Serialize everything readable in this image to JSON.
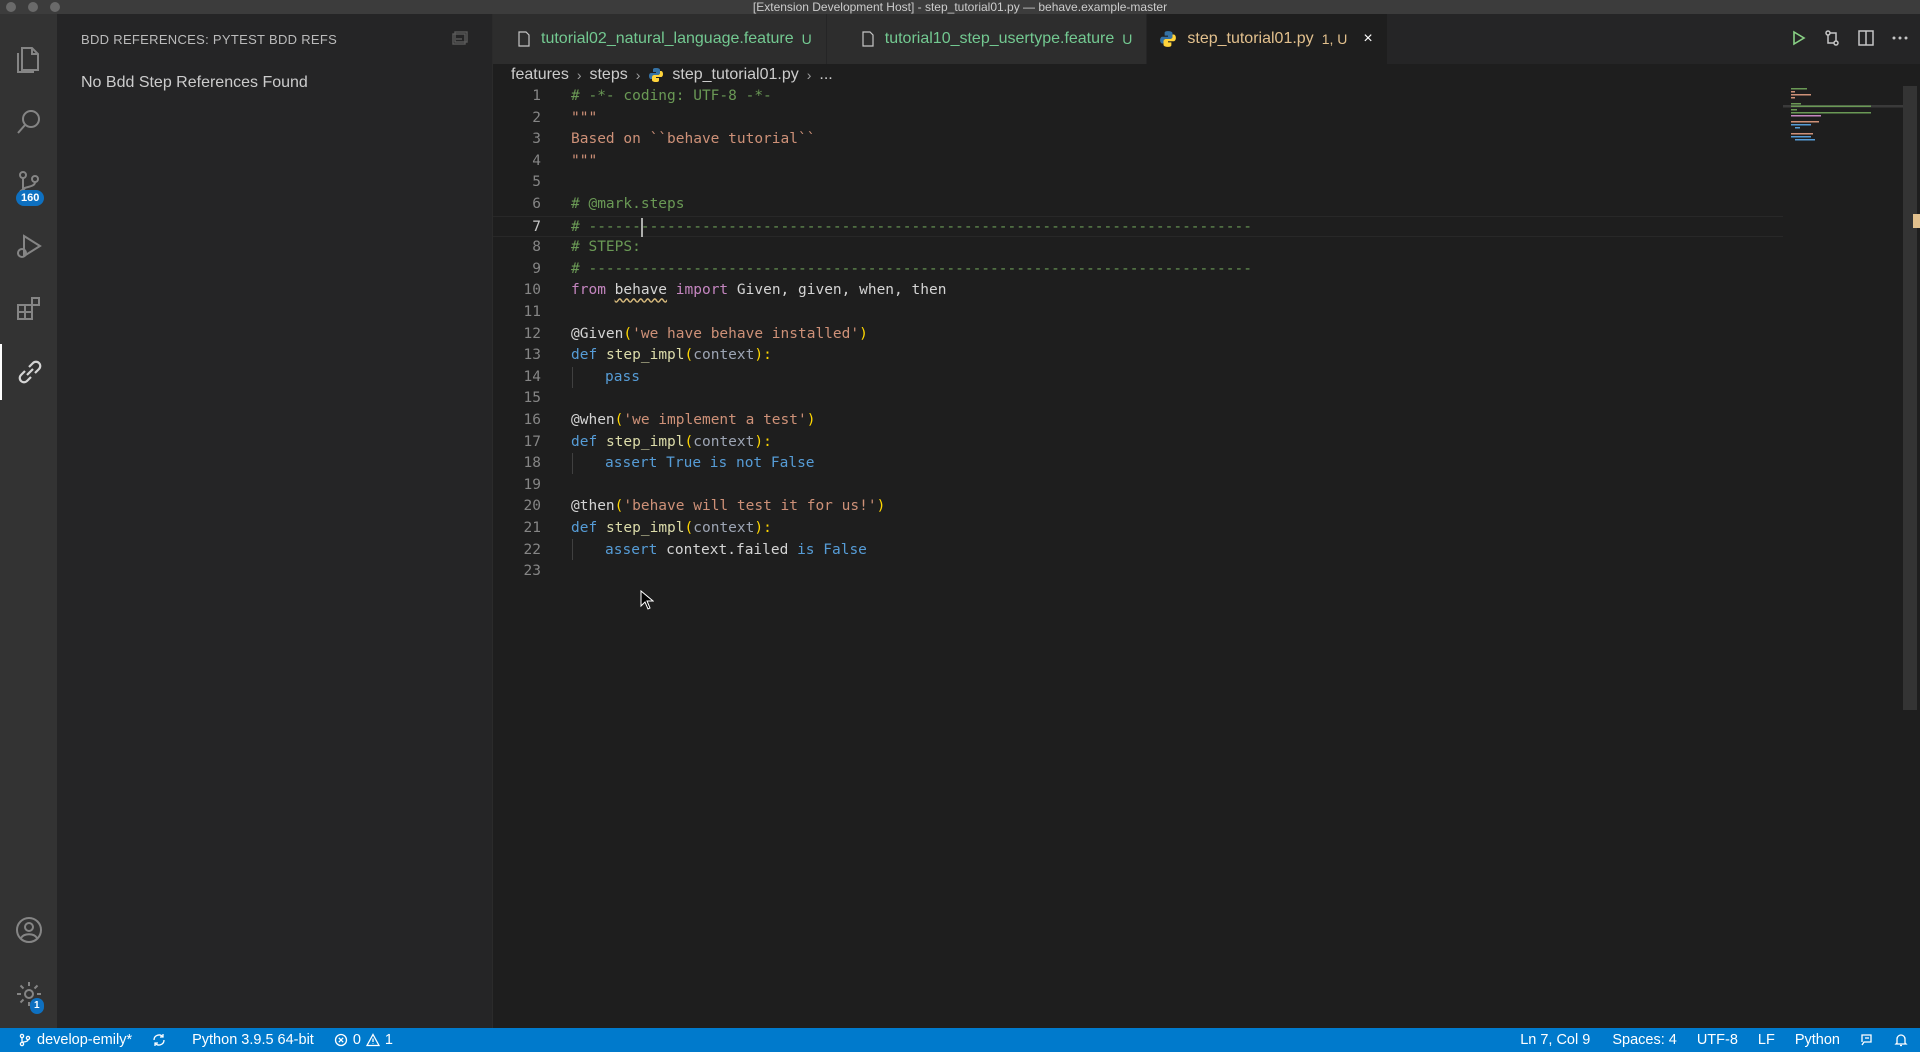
{
  "window": {
    "title": "[Extension Development Host] - step_tutorial01.py — behave.example-master"
  },
  "activity_bar": {
    "items": [
      "explorer-icon",
      "search-icon",
      "source-control-icon",
      "run-debug-icon",
      "extensions-icon",
      "bdd-references-icon"
    ],
    "scm_badge": "160",
    "settings_badge": "1",
    "accent": "#0e70c0"
  },
  "sidebar": {
    "title": "BDD REFERENCES: PYTEST BDD REFS",
    "message": "No Bdd Step References Found"
  },
  "tabs": [
    {
      "label": "tutorial02_natural_language.feature",
      "status": "U"
    },
    {
      "label": "tutorial10_step_usertype.feature",
      "status": "U"
    },
    {
      "label": "step_tutorial01.py",
      "status": "1, U",
      "close": "×"
    }
  ],
  "breadcrumbs": [
    "features",
    "steps",
    "step_tutorial01.py",
    "..."
  ],
  "editor": {
    "current_line": 7,
    "line_numbers": [
      "1",
      "2",
      "3",
      "4",
      "5",
      "6",
      "7",
      "8",
      "9",
      "10",
      "11",
      "12",
      "13",
      "14",
      "15",
      "16",
      "17",
      "18",
      "19",
      "20",
      "21",
      "22",
      "23"
    ],
    "lines": {
      "l1": "# -*- coding: UTF-8 -*-",
      "l2": "\"\"\"",
      "l3": "Based on ``behave tutorial``",
      "l4": "\"\"\"",
      "l6": "# @mark.steps",
      "l7": "# ----------------------------------------------------------------------------",
      "l8": "# STEPS:",
      "l9": "# ----------------------------------------------------------------------------",
      "l10": {
        "kw1": "from",
        "mod": "behave",
        "kw2": "import",
        "names": "Given, given, when, then"
      },
      "l12": {
        "deco": "@Given",
        "p1": "(",
        "str": "'we have behave installed'",
        "p2": ")"
      },
      "l13": {
        "kw": "def",
        "fn": "step_impl",
        "p1": "(",
        "param": "context",
        "p2": "):"
      },
      "l14": {
        "kw": "pass"
      },
      "l16": {
        "deco": "@when",
        "p1": "(",
        "str": "'we implement a test'",
        "p2": ")"
      },
      "l17": {
        "kw": "def",
        "fn": "step_impl",
        "p1": "(",
        "param": "context",
        "p2": "):"
      },
      "l18": {
        "kw": "assert",
        "rest": "True is not False"
      },
      "l20": {
        "deco": "@then",
        "p1": "(",
        "str": "'behave will test it for us!'",
        "p2": ")"
      },
      "l21": {
        "kw": "def",
        "fn": "step_impl",
        "p1": "(",
        "param": "context",
        "p2": "):"
      },
      "l22": {
        "kw": "assert",
        "var": "context.failed",
        "rest": "is False"
      }
    }
  },
  "statusbar": {
    "branch": "develop-emily*",
    "python": "Python 3.9.5 64-bit",
    "errors": "0",
    "warnings": "1",
    "position": "Ln 7, Col 9",
    "spaces": "Spaces: 4",
    "encoding": "UTF-8",
    "eol": "LF",
    "language": "Python",
    "color": "#007acc"
  }
}
